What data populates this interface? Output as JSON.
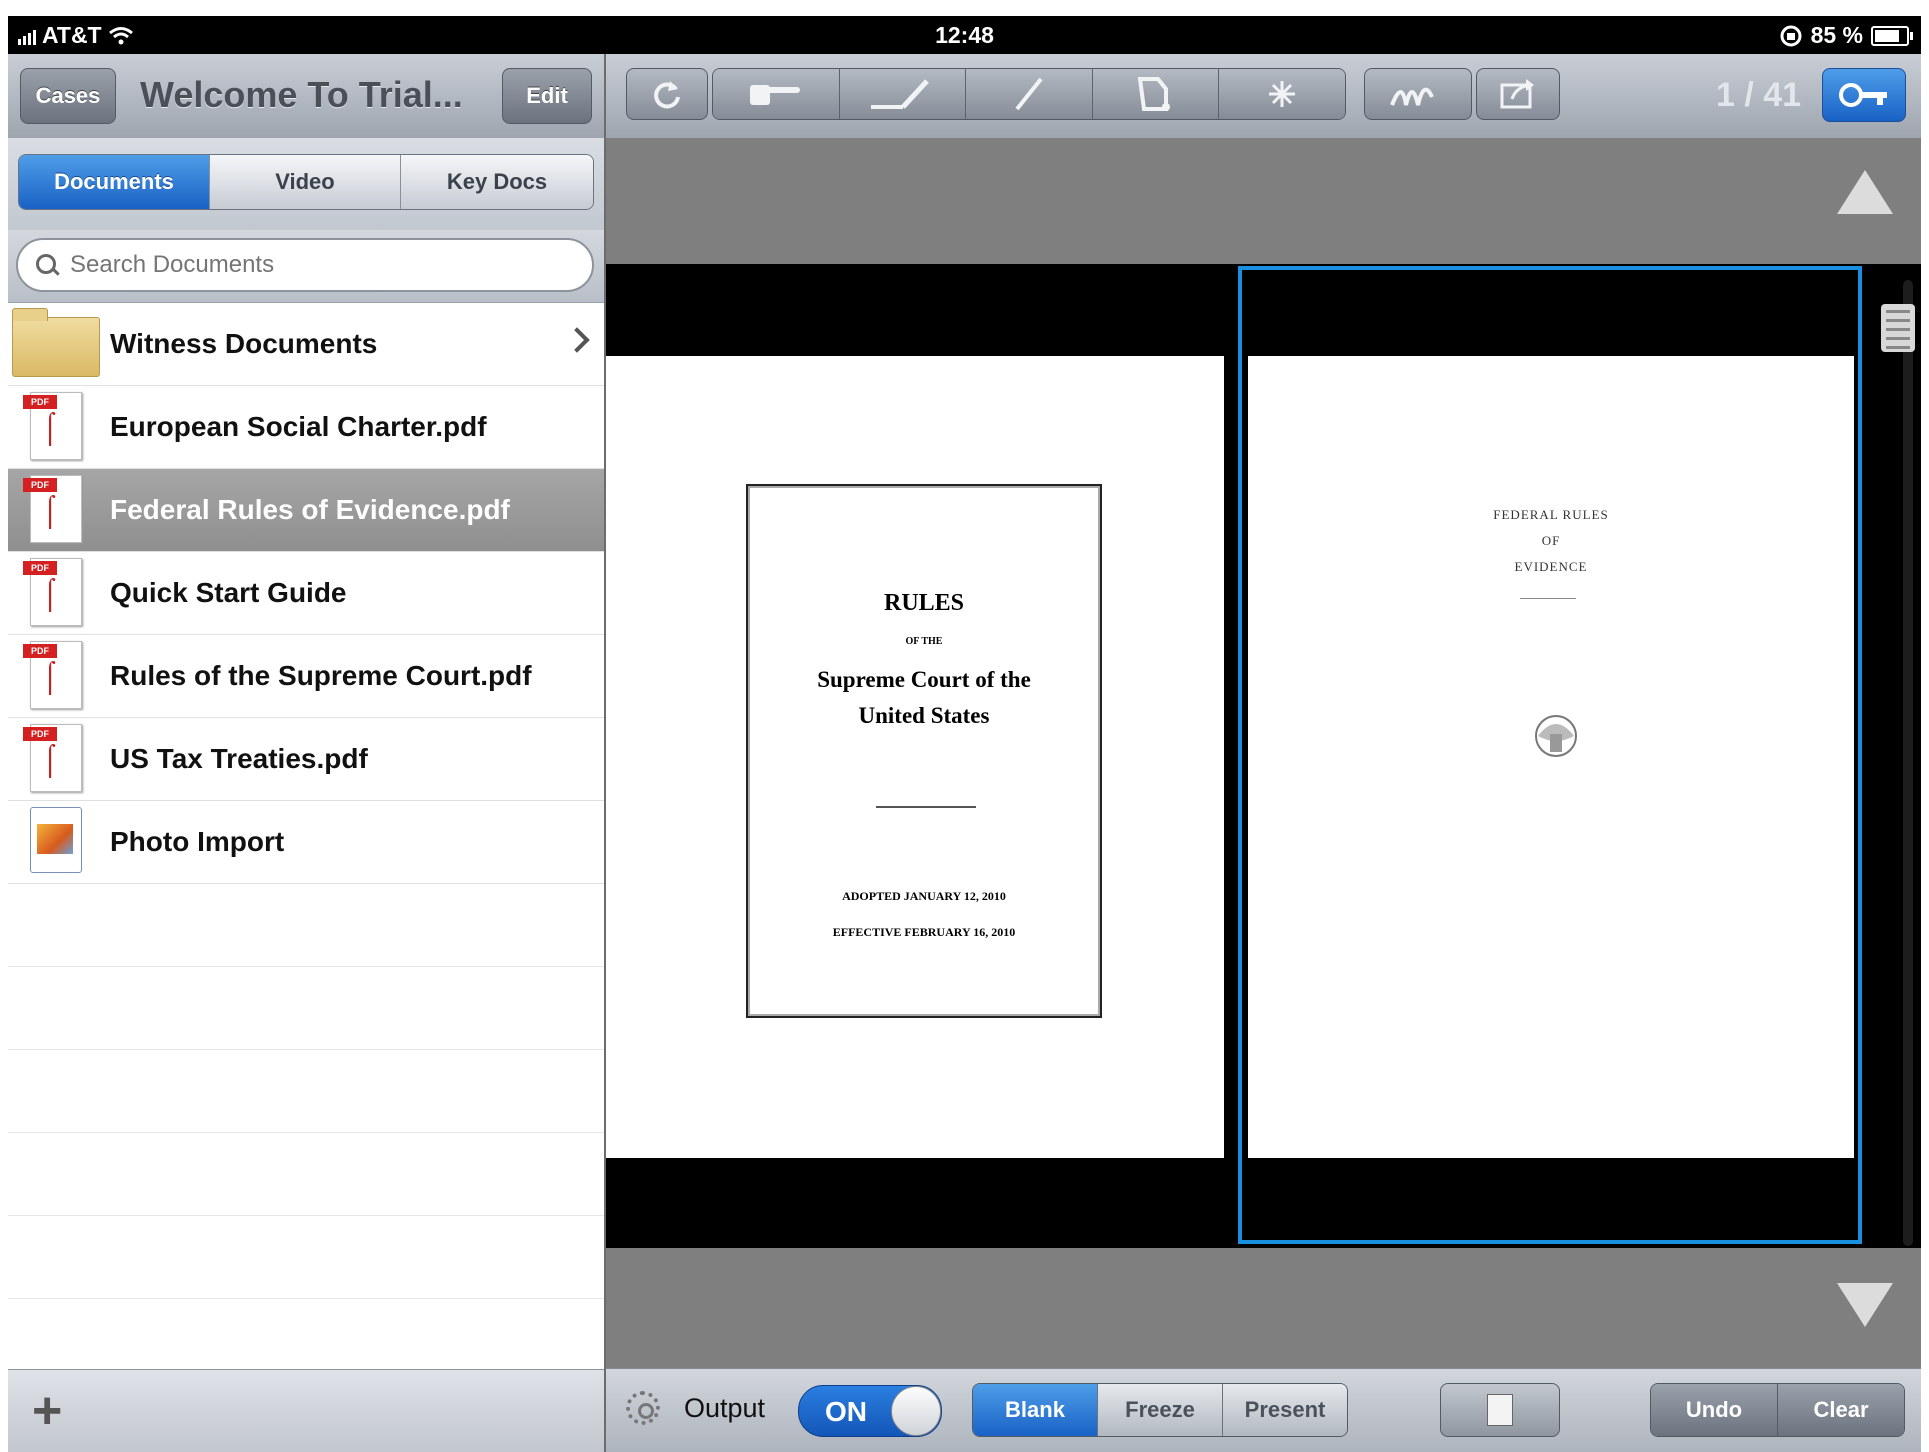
{
  "status_bar": {
    "carrier": "AT&T",
    "time": "12:48",
    "battery": "85 %"
  },
  "nav": {
    "cases_label": "Cases",
    "title": "Welcome To Trial...",
    "edit_label": "Edit"
  },
  "tabs": [
    "Documents",
    "Video",
    "Key Docs"
  ],
  "search": {
    "placeholder": "Search Documents"
  },
  "documents": [
    {
      "label": "Witness Documents",
      "icon": "folder-icon"
    },
    {
      "label": "European Social Charter.pdf",
      "icon": "pdf-icon"
    },
    {
      "label": "Federal Rules of Evidence.pdf",
      "icon": "pdf-icon",
      "selected": true
    },
    {
      "label": "Quick Start Guide",
      "icon": "pdf-icon"
    },
    {
      "label": "Rules of the Supreme Court.pdf",
      "icon": "pdf-icon"
    },
    {
      "label": "US Tax Treaties.pdf",
      "icon": "pdf-icon"
    },
    {
      "label": "Photo Import",
      "icon": "photo-icon"
    }
  ],
  "pdf_badge": "PDF",
  "pdf_vendor": "Adobe",
  "toolbar": {
    "page_indicator": "1 / 41"
  },
  "page_left": {
    "title": "RULES",
    "of_the": "OF THE",
    "subtitle_1": "Supreme Court of the",
    "subtitle_2": "United States",
    "adopted": "ADOPTED JANUARY 12, 2010",
    "effective": "EFFECTIVE FEBRUARY 16, 2010"
  },
  "page_right": {
    "line_1": "FEDERAL RULES",
    "line_2": "OF",
    "line_3": "EVIDENCE"
  },
  "bottom": {
    "output_label": "Output",
    "toggle_label": "ON",
    "modes": [
      "Blank",
      "Freeze",
      "Present"
    ],
    "undo_label": "Undo",
    "clear_label": "Clear"
  },
  "colors": {
    "accent_blue": "#1a62c6",
    "selection_border": "#1a8fe0",
    "viewer_gray": "#7f7f7f"
  }
}
